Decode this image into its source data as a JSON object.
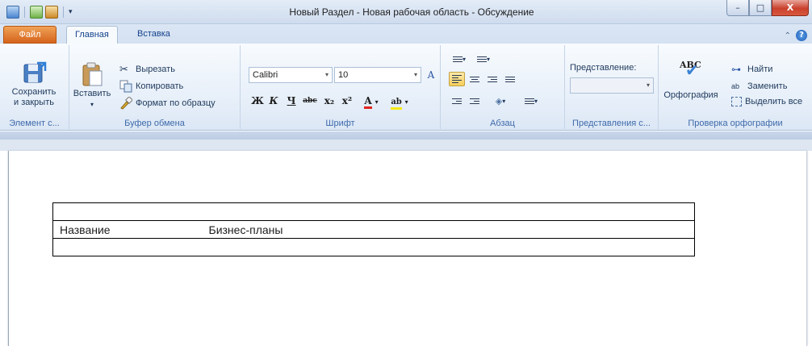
{
  "window": {
    "title": "Новый Раздел - Новая рабочая область - Обсуждение",
    "minimize": "–",
    "maximize": "□",
    "close": "X"
  },
  "tabs": {
    "file": "Файл",
    "home": "Главная",
    "insert": "Вставка"
  },
  "ribbon": {
    "element_group": {
      "label": "Элемент с...",
      "save_close": "Сохранить\nи закрыть"
    },
    "clipboard": {
      "label": "Буфер обмена",
      "paste": "Вставить",
      "cut": "Вырезать",
      "copy": "Копировать",
      "format_painter": "Формат по образцу"
    },
    "font": {
      "label": "Шрифт",
      "family": "Calibri",
      "size": "10",
      "bold": "Ж",
      "italic": "К",
      "underline": "Ч",
      "strike": "abc",
      "subscript": "x₂",
      "superscript": "x²",
      "font_color": "A",
      "highlight": "ab"
    },
    "paragraph": {
      "label": "Абзац"
    },
    "views": {
      "label": "Представления с...",
      "view_label": "Представление:",
      "view_value": ""
    },
    "proofing": {
      "label": "Проверка орфографии",
      "spelling": "Орфография",
      "abc": "ABC",
      "find": "Найти",
      "replace": "Заменить",
      "select_all": "Выделить все"
    }
  },
  "document": {
    "rows": [
      {
        "label": "",
        "value": ""
      },
      {
        "label": "Название",
        "value": "Бизнес-планы"
      },
      {
        "label": "",
        "value": ""
      }
    ]
  },
  "colors": {
    "accent": "#d5631c",
    "ribbon_label": "#3e6aaa"
  }
}
